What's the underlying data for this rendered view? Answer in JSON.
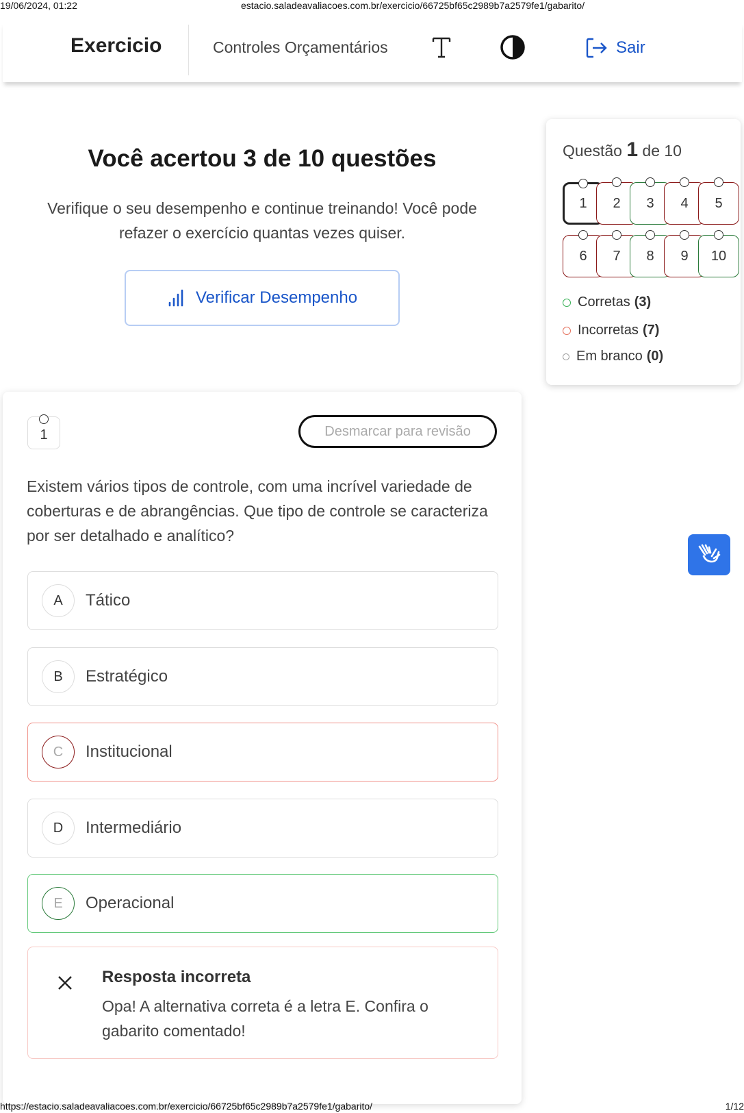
{
  "print_header": {
    "datetime": "19/06/2024, 01:22",
    "url": "estacio.saladeavaliacoes.com.br/exercicio/66725bf65c2989b7a2579fe1/gabarito/"
  },
  "print_footer": {
    "url": "https://estacio.saladeavaliacoes.com.br/exercicio/66725bf65c2989b7a2579fe1/gabarito/",
    "page": "1/12"
  },
  "navbar": {
    "title": "Exercicio",
    "subject": "Controles Orçamentários",
    "font_icon": "font-size-icon",
    "contrast_icon": "contrast-icon",
    "exit_label": "Sair",
    "accent_color": "#1a56c9"
  },
  "result": {
    "title": "Você acertou 3 de 10 questões",
    "subtitle": "Verifique o seu desempenho e continue treinando! Você pode refazer o exercício quantas vezes quiser.",
    "button_label": "Verificar Desempenho"
  },
  "sidebar": {
    "question_prefix": "Questão",
    "current_question": "1",
    "question_suffix": "de 10",
    "questions": [
      {
        "label": "1",
        "status": "current"
      },
      {
        "label": "2",
        "status": "incorrect"
      },
      {
        "label": "3",
        "status": "correct"
      },
      {
        "label": "4",
        "status": "incorrect"
      },
      {
        "label": "5",
        "status": "incorrect"
      },
      {
        "label": "6",
        "status": "incorrect"
      },
      {
        "label": "7",
        "status": "incorrect"
      },
      {
        "label": "8",
        "status": "correct"
      },
      {
        "label": "9",
        "status": "incorrect"
      },
      {
        "label": "10",
        "status": "correct"
      }
    ],
    "legend": [
      {
        "label": "Corretas",
        "count": "(3)",
        "color": "#3cb35a"
      },
      {
        "label": "Incorretas",
        "count": "(7)",
        "color": "#e5735f"
      },
      {
        "label": "Em branco",
        "count": "(0)",
        "color": "#999999"
      }
    ]
  },
  "question": {
    "number": "1",
    "review_button": "Desmarcar para revisão",
    "text": "Existem vários tipos de controle, com uma incrível variedade de coberturas e de abrangências. Que tipo de controle se caracteriza por ser detalhado e analítico?",
    "options": [
      {
        "letter": "A",
        "text": "Tático",
        "state": "default"
      },
      {
        "letter": "B",
        "text": "Estratégico",
        "state": "default"
      },
      {
        "letter": "C",
        "text": "Institucional",
        "state": "wrong"
      },
      {
        "letter": "D",
        "text": "Intermediário",
        "state": "default"
      },
      {
        "letter": "E",
        "text": "Operacional",
        "state": "right"
      }
    ],
    "feedback": {
      "title": "Resposta incorreta",
      "text": "Opa! A alternativa correta é a letra E. Confira o gabarito comentado!"
    }
  },
  "accessibility": {
    "libras_icon": "sign-language-hands-icon"
  }
}
